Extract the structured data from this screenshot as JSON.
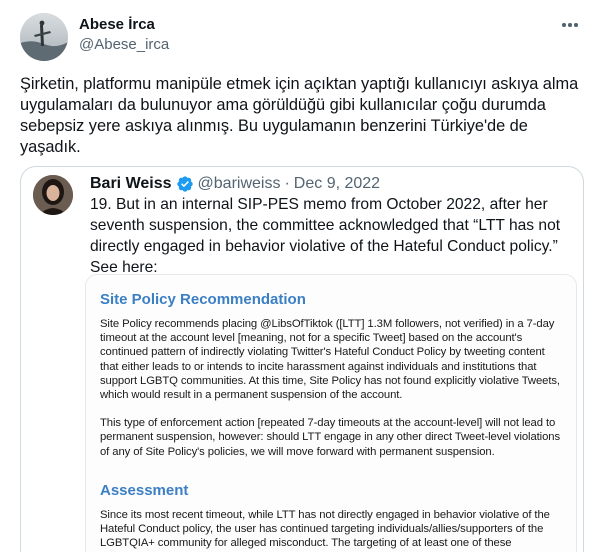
{
  "tweet": {
    "display_name": "Abese İrca",
    "handle": "@Abese_irca",
    "more_icon": "more-horizontal-icon",
    "text": "Şirketin, platformu manipüle etmek için açıktan yaptığı kullanıcıyı askıya alma uygulamaları da bulunuyor ama görüldüğü gibi kullanıcılar çoğu durumda sebepsiz yere askıya alınmış. Bu uygulamanın benzerini Türkiye'de de yaşadık."
  },
  "quote": {
    "display_name": "Bari Weiss",
    "verified_icon": "verified-badge-icon",
    "handle": "@bariweiss",
    "separator": "·",
    "date": "Dec 9, 2022",
    "text": "19. But in an internal SIP-PES memo from October 2022, after her seventh suspension, the committee acknowledged that “LTT has not directly engaged in behavior violative of the Hateful Conduct policy.” See here:",
    "document": {
      "heading1": "Site Policy Recommendation",
      "para1": "Site Policy recommends placing @LibsOfTiktok ([LTT] 1.3M followers, not verified) in a 7-day timeout at the account level [meaning, not for a specific Tweet] based on the account's continued pattern of indirectly violating Twitter's Hateful Conduct Policy by tweeting content that either leads to or intends to incite harassment against individuals and institutions that support LGBTQ communities. At this time, Site Policy has not found explicitly violative Tweets, which would result in a permanent suspension of the account.",
      "para2": "This type of enforcement action [repeated 7-day timeouts at the account-level] will not lead to permanent suspension, however: should LTT engage in any other direct Tweet-level violations of any of Site Policy's policies, we will move forward with permanent suspension.",
      "heading2": "Assessment",
      "para3": "Since its most recent timeout, while LTT has not directly engaged in behavior violative of the Hateful Conduct policy, the user has continued targeting individuals/allies/supporters of the LGBTQIA+ community for alleged misconduct. The targeting of at least one of these institutions"
    }
  },
  "colors": {
    "text": "#0f1419",
    "secondary": "#536471",
    "border": "#cfd9de",
    "verified": "#1d9bf0",
    "doc_heading": "#3b7fc4"
  }
}
